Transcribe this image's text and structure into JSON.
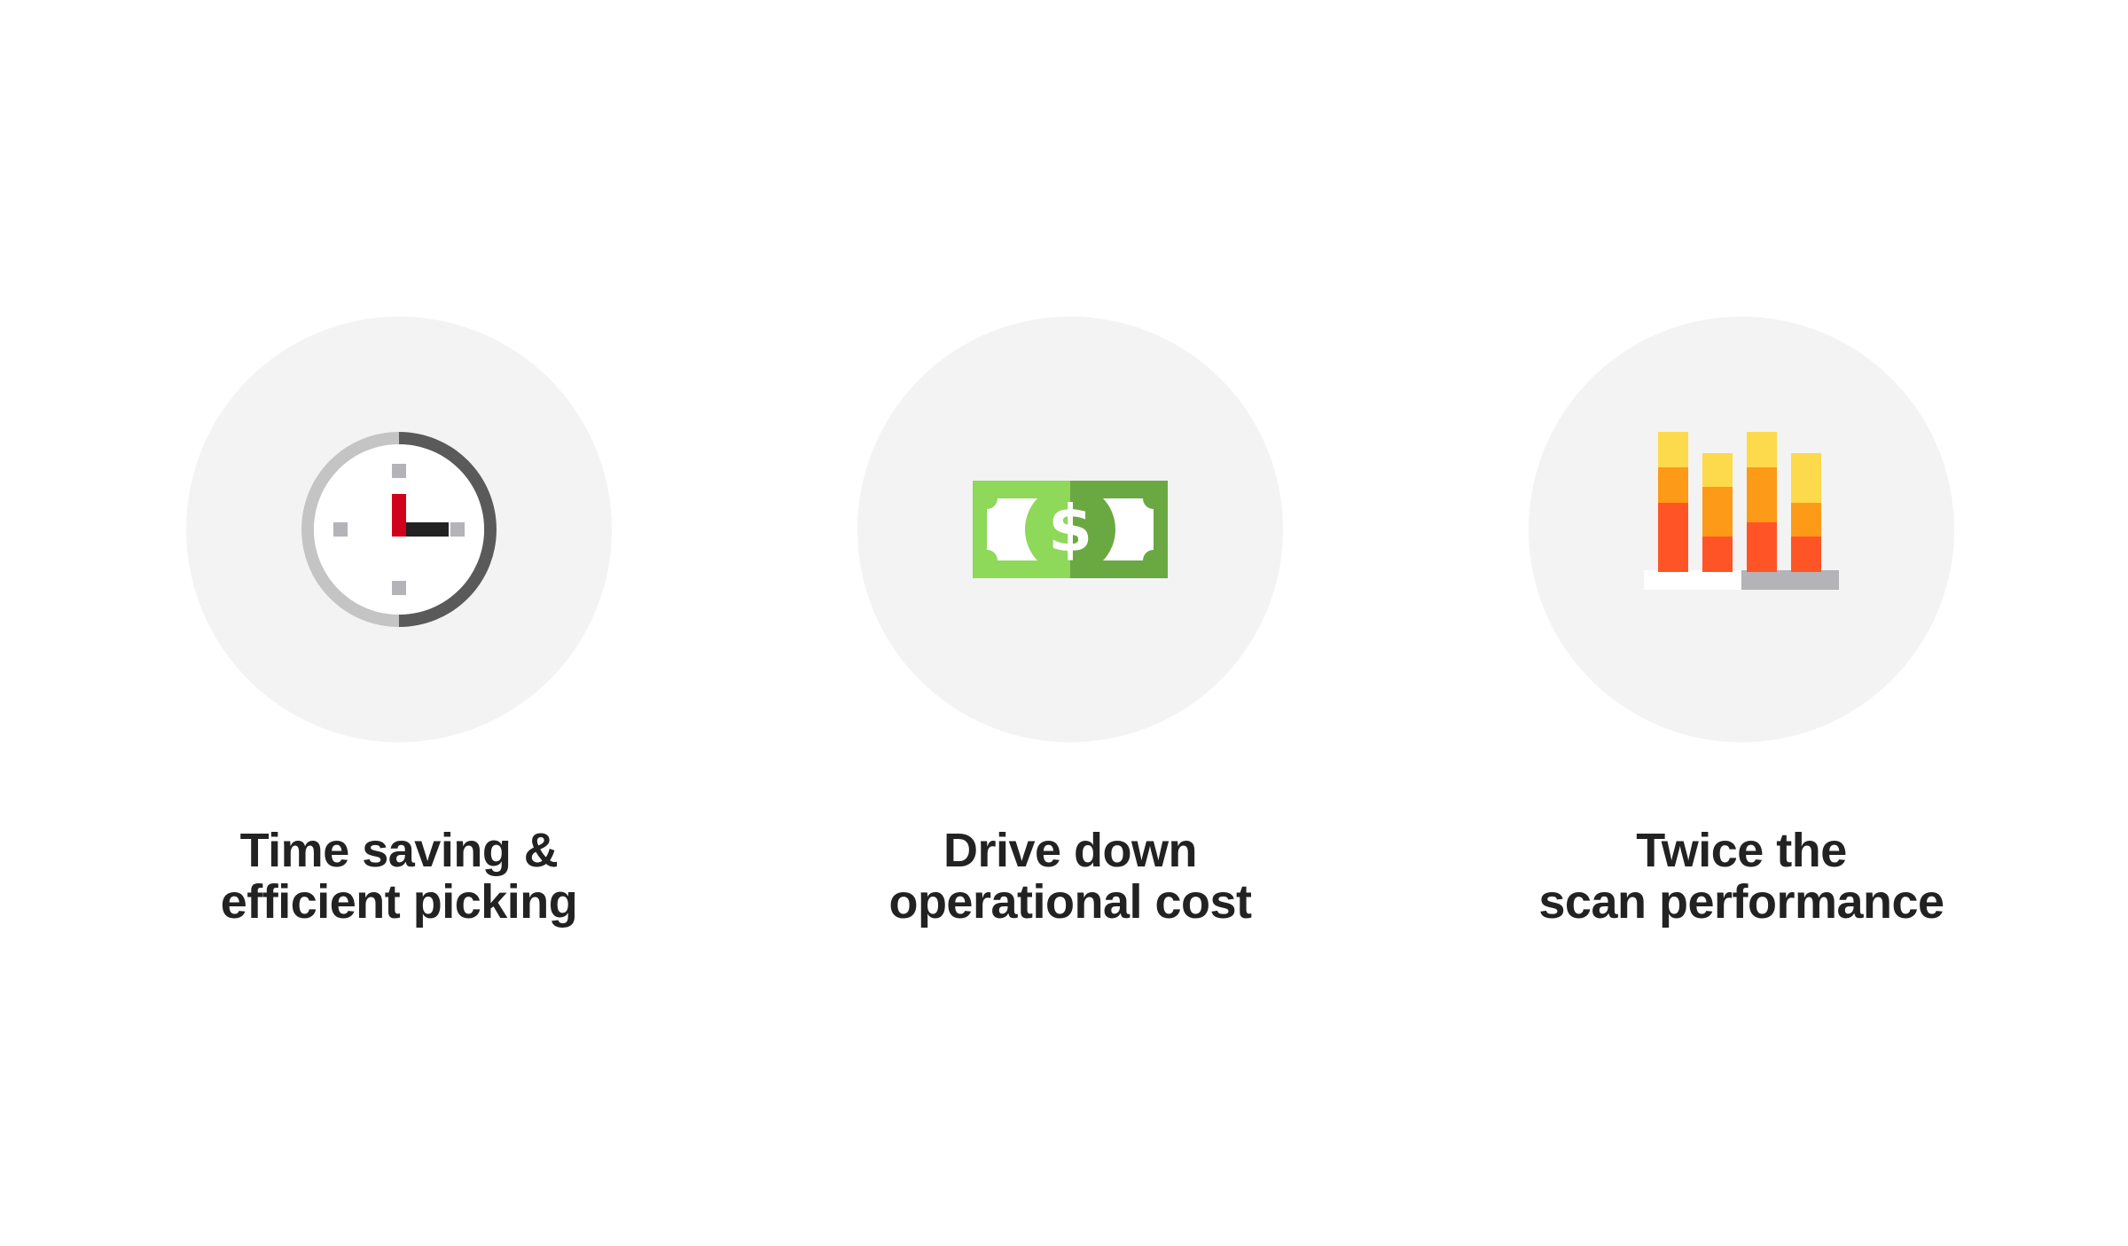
{
  "features": [
    {
      "icon": "clock-icon",
      "caption_line1": "Time saving &",
      "caption_line2": "efficient picking"
    },
    {
      "icon": "money-bill-icon",
      "caption_line1": "Drive down",
      "caption_line2": "operational cost"
    },
    {
      "icon": "bar-chart-icon",
      "caption_line1": "Twice the",
      "caption_line2": "scan performance"
    }
  ],
  "colors": {
    "circle_bg": "#f3f3f3",
    "text": "#222222",
    "clock_light": "#c4c4c4",
    "clock_dark": "#5a5a5a",
    "clock_red": "#d0021b",
    "money_light": "#8ed85a",
    "money_dark": "#6aa842",
    "bar_yellow": "#fdd94c",
    "bar_orange": "#fd9a18",
    "bar_red": "#ff5526",
    "bar_base": "#b3b3b8"
  }
}
